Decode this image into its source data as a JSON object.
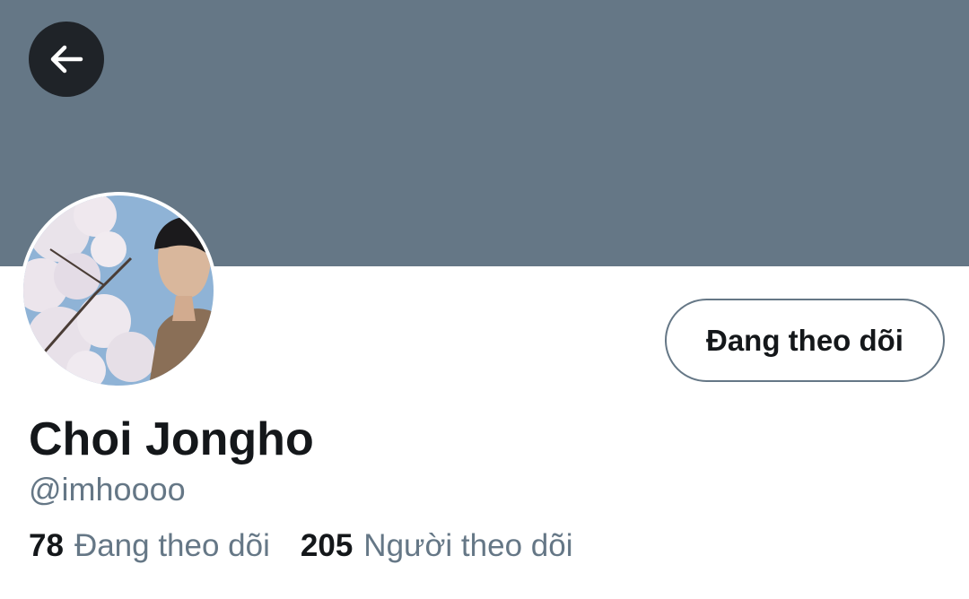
{
  "profile": {
    "display_name": "Choi Jongho",
    "handle": "@imhoooo"
  },
  "actions": {
    "follow_state_label": "Đang theo dõi"
  },
  "stats": {
    "following_count": "78",
    "following_label": "Đang theo dõi",
    "followers_count": "205",
    "followers_label": "Người theo dõi"
  },
  "icons": {
    "back": "arrow-left-icon"
  },
  "colors": {
    "banner": "#657786",
    "text_primary": "#14171a",
    "text_secondary": "#657786",
    "back_button_bg": "#1f2328"
  }
}
